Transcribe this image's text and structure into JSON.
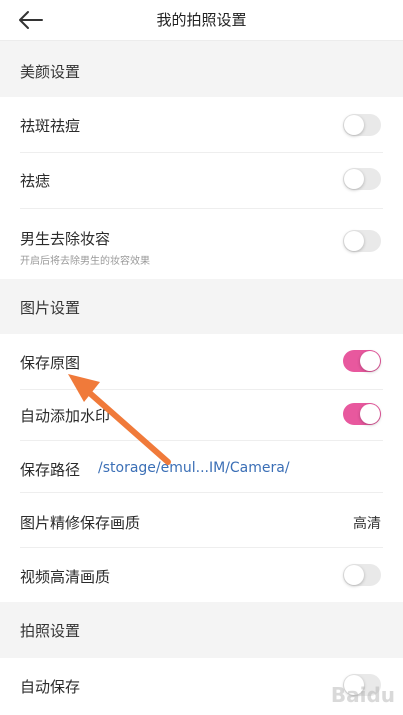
{
  "header": {
    "title": "我的拍照设置"
  },
  "sections": {
    "beauty": "美颜设置",
    "image": "图片设置",
    "camera": "拍照设置"
  },
  "rows": {
    "freckle": {
      "label": "祛斑祛痘",
      "on": false
    },
    "acne": {
      "label": "祛痣",
      "on": false
    },
    "male_makeup": {
      "label": "男生去除妆容",
      "sub": "开启后将去除男生的妆容效果",
      "on": false
    },
    "save_original": {
      "label": "保存原图",
      "on": true
    },
    "watermark": {
      "label": "自动添加水印",
      "on": true
    },
    "save_path": {
      "label": "保存路径",
      "value": "/storage/emul...IM/Camera/"
    },
    "retouch_quality": {
      "label": "图片精修保存画质",
      "value": "高清"
    },
    "video_hd": {
      "label": "视频高清画质",
      "on": false
    },
    "auto_save": {
      "label": "自动保存",
      "on": false
    }
  },
  "colors": {
    "accent": "#e8589e",
    "arrow": "#f07a3a",
    "link": "#3b6fb6"
  },
  "watermark_logo": "Baidu"
}
